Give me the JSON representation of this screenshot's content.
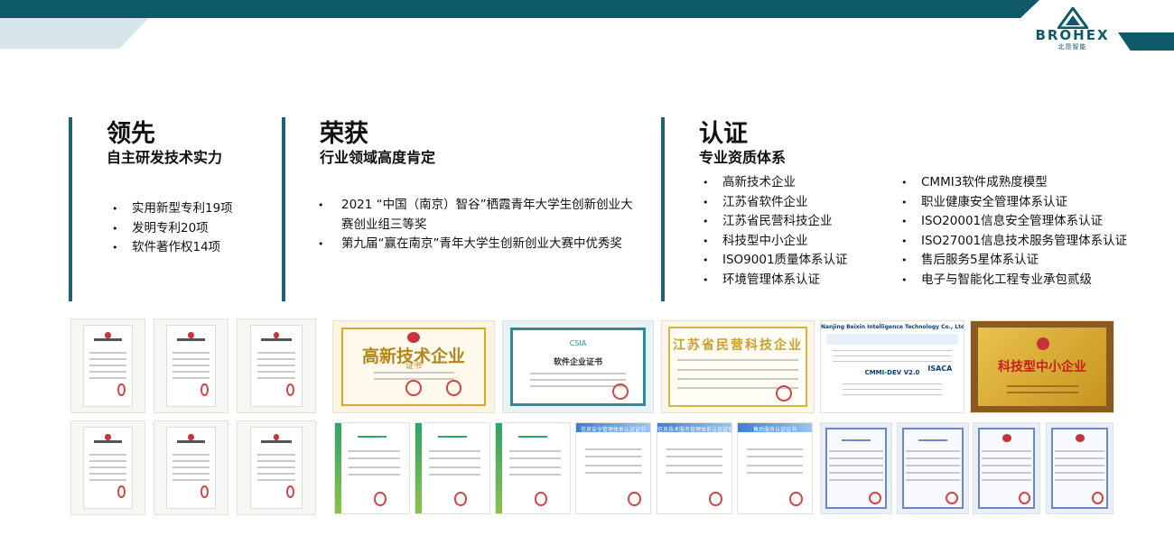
{
  "brand": {
    "name": "BROHEX",
    "sub": "北昂智能",
    "accent": "#0e5a6b"
  },
  "col1": {
    "title": "领先",
    "subtitle": "自主研发技术实力",
    "items": [
      "实用新型专利19项",
      "发明专利20项",
      "软件著作权14项"
    ]
  },
  "col2": {
    "title": "荣获",
    "subtitle": "行业领域高度肯定",
    "items": [
      "2021 “中国（南京）智谷”栖霞青年大学生创新创业大赛创业组三等奖",
      "第九届“赢在南京”青年大学生创新创业大赛中优秀奖"
    ]
  },
  "col3": {
    "title": "认证",
    "subtitle": "专业资质体系",
    "items_left": [
      "高新技术企业",
      "江苏省软件企业",
      "江苏省民营科技企业",
      "科技型中小企业",
      "ISO9001质量体系认证",
      "环境管理体系认证"
    ],
    "items_right": [
      "CMMI3软件成熟度模型",
      "职业健康安全管理体系认证",
      "ISO20001信息安全管理体系认证",
      "ISO27001信息技术服务管理体系认证",
      "售后服务5星体系认证",
      "电子与智能化工程专业承包贰级"
    ]
  },
  "certs": {
    "high_tech": "高新技术企业",
    "high_tech_sub": "证书",
    "software": "软件企业证书",
    "private_tech": "江苏省民营科技企业",
    "cmmi_org": "Nanjing Beixin Intelligence Technology Co., Ltd.",
    "cmmi_level": "CMMI-DEV V2.0",
    "cmmi_isaca": "ISACA",
    "sme": "科技型中小企业",
    "patent": "实用新型专利证书",
    "info_sec": "信息安全管理体系认证证书",
    "it_service": "信息技术服务管理体系认证证书",
    "after_sale": "售后服务认证证书"
  }
}
